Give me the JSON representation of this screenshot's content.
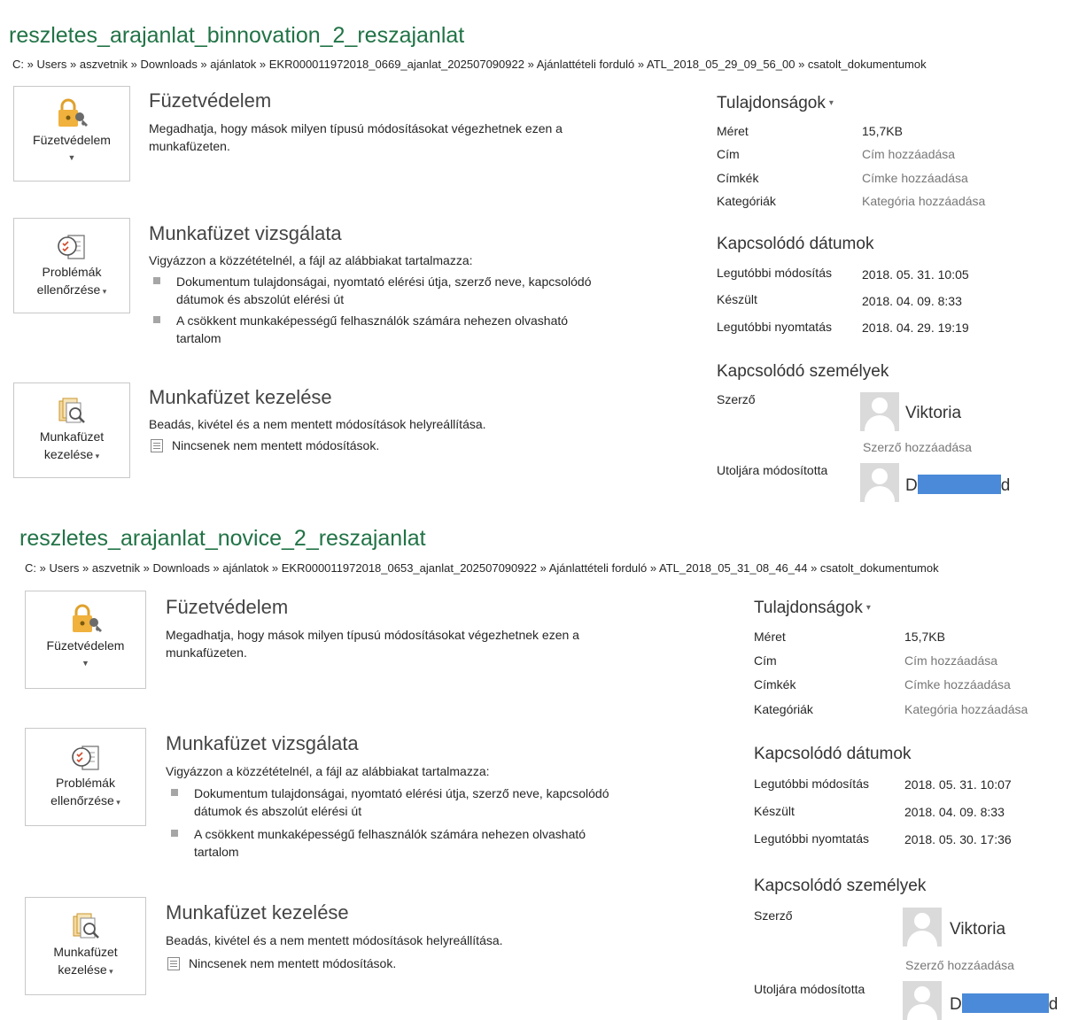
{
  "panels": [
    {
      "title": "reszletes_arajanlat_binnovation_2_reszajanlat",
      "breadcrumb": "C: » Users » aszvetnik » Downloads » ajánlatok » EKR000011972018_0669_ajanlat_202507090922 » Ajánlattételi forduló » ATL_2018_05_29_09_56_00 » csatolt_dokumentumok",
      "protect": {
        "tile_label": "Füzetvédelem",
        "heading": "Füzetvédelem",
        "desc": "Megadhatja, hogy mások milyen típusú módosításokat végezhetnek ezen a munkafüzeten."
      },
      "inspect": {
        "tile_label_1": "Problémák",
        "tile_label_2": "ellenőrzése",
        "heading": "Munkafüzet vizsgálata",
        "desc": "Vigyázzon a közzétételnél, a fájl az alábbiakat tartalmazza:",
        "bullets": [
          "Dokumentum tulajdonságai, nyomtató elérési útja, szerző neve, kapcsolódó dátumok és abszolút elérési út",
          "A csökkent munkaképességű felhasználók számára nehezen olvasható tartalom"
        ]
      },
      "manage": {
        "tile_label_1": "Munkafüzet",
        "tile_label_2": "kezelése",
        "heading": "Munkafüzet kezelése",
        "desc": "Beadás, kivétel és a nem mentett módosítások helyreállítása.",
        "note": "Nincsenek nem mentett módosítások."
      },
      "properties": {
        "heading": "Tulajdonságok",
        "rows": [
          {
            "label": "Méret",
            "value": "15,7KB",
            "link": false
          },
          {
            "label": "Cím",
            "value": "Cím hozzáadása",
            "link": true
          },
          {
            "label": "Címkék",
            "value": "Címke hozzáadása",
            "link": true
          },
          {
            "label": "Kategóriák",
            "value": "Kategória hozzáadása",
            "link": true
          }
        ]
      },
      "dates": {
        "heading": "Kapcsolódó dátumok",
        "rows": [
          {
            "label": "Legutóbbi módosítás",
            "value": "2018. 05. 31. 10:05"
          },
          {
            "label": "Készült",
            "value": "2018. 04. 09. 8:33"
          },
          {
            "label": "Legutóbbi nyomtatás",
            "value": "2018. 04. 29. 19:19"
          }
        ]
      },
      "people": {
        "heading": "Kapcsolódó személyek",
        "author_label": "Szerző",
        "author_name": "Viktoria",
        "add_author": "Szerző hozzáadása",
        "modified_label": "Utoljára módosította",
        "modified_name_start": "D",
        "modified_name_end": "d"
      }
    },
    {
      "title": "reszletes_arajanlat_novice_2_reszajanlat",
      "breadcrumb": "C: » Users » aszvetnik » Downloads » ajánlatok » EKR000011972018_0653_ajanlat_202507090922 » Ajánlattételi forduló » ATL_2018_05_31_08_46_44 » csatolt_dokumentumok",
      "protect": {
        "tile_label": "Füzetvédelem",
        "heading": "Füzetvédelem",
        "desc": "Megadhatja, hogy mások milyen típusú módosításokat végezhetnek ezen a munkafüzeten."
      },
      "inspect": {
        "tile_label_1": "Problémák",
        "tile_label_2": "ellenőrzése",
        "heading": "Munkafüzet vizsgálata",
        "desc": "Vigyázzon a közzétételnél, a fájl az alábbiakat tartalmazza:",
        "bullets": [
          "Dokumentum tulajdonságai, nyomtató elérési útja, szerző neve, kapcsolódó dátumok és abszolút elérési út",
          "A csökkent munkaképességű felhasználók számára nehezen olvasható tartalom"
        ]
      },
      "manage": {
        "tile_label_1": "Munkafüzet",
        "tile_label_2": "kezelése",
        "heading": "Munkafüzet kezelése",
        "desc": "Beadás, kivétel és a nem mentett módosítások helyreállítása.",
        "note": "Nincsenek nem mentett módosítások."
      },
      "properties": {
        "heading": "Tulajdonságok",
        "rows": [
          {
            "label": "Méret",
            "value": "15,7KB",
            "link": false
          },
          {
            "label": "Cím",
            "value": "Cím hozzáadása",
            "link": true
          },
          {
            "label": "Címkék",
            "value": "Címke hozzáadása",
            "link": true
          },
          {
            "label": "Kategóriák",
            "value": "Kategória hozzáadása",
            "link": true
          }
        ]
      },
      "dates": {
        "heading": "Kapcsolódó dátumok",
        "rows": [
          {
            "label": "Legutóbbi módosítás",
            "value": "2018. 05. 31. 10:07"
          },
          {
            "label": "Készült",
            "value": "2018. 04. 09. 8:33"
          },
          {
            "label": "Legutóbbi nyomtatás",
            "value": "2018. 05. 30. 17:36"
          }
        ]
      },
      "people": {
        "heading": "Kapcsolódó személyek",
        "author_label": "Szerző",
        "author_name": "Viktoria",
        "add_author": "Szerző hozzáadása",
        "modified_label": "Utoljára módosította",
        "modified_name_start": "D",
        "modified_name_end": "d"
      }
    }
  ],
  "colors": {
    "title": "#217346",
    "link_gray": "#777777",
    "redaction": "#4a8ad8",
    "lock": "#f0b13d"
  },
  "icons": [
    "lock-key-icon",
    "inspect-checklist-icon",
    "manage-workbook-icon",
    "document-icon",
    "person-avatar-icon",
    "dropdown-caret-icon"
  ]
}
